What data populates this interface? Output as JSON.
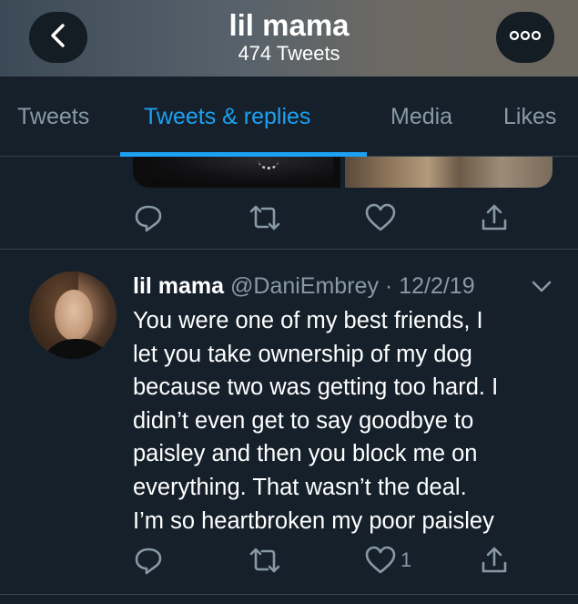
{
  "header": {
    "title": "lil mama",
    "subtitle": "474 Tweets"
  },
  "tabs": [
    {
      "label": "Tweets",
      "active": false
    },
    {
      "label": "Tweets & replies",
      "active": true
    },
    {
      "label": "Media",
      "active": false
    },
    {
      "label": "Likes",
      "active": false
    }
  ],
  "tweet": {
    "display_name": "lil mama",
    "handle": "@DaniEmbrey",
    "separator": "·",
    "date": "12/2/19",
    "lines": [
      "You were one of my best friends, I",
      "let you take ownership of my dog",
      "because two was getting too hard. I",
      "didn’t even get to say goodbye to",
      "paisley and then you block me on",
      "everything. That wasn’t the deal.",
      "I’m so heartbroken my poor paisley"
    ],
    "like_count": "1"
  },
  "icons": {
    "back": "chevron-left-icon",
    "more": "more-dots-icon",
    "reply": "reply-icon",
    "retweet": "retweet-icon",
    "like": "heart-icon",
    "share": "share-icon",
    "caret": "chevron-down-icon"
  },
  "colors": {
    "background": "#15202b",
    "accent": "#1da1f2",
    "muted": "#8899a6",
    "divider": "#38444d"
  }
}
